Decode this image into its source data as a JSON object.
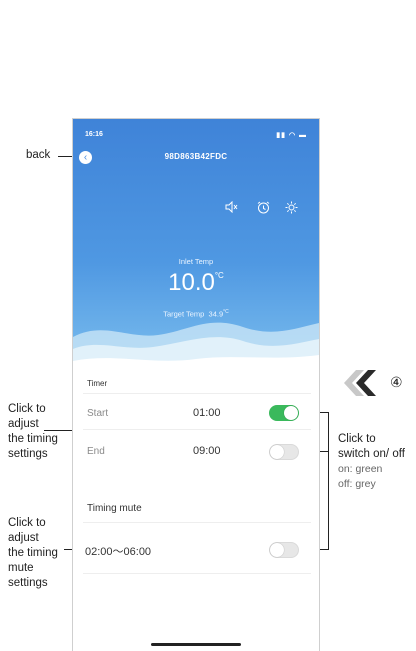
{
  "status_bar": {
    "time": "16:16",
    "icons": "signal-wifi-battery"
  },
  "header": {
    "device_id": "98D863B42FDC",
    "back_label": "back",
    "icons": [
      "mute-icon",
      "alarm-clock-icon",
      "sun-icon"
    ],
    "inlet_label": "Inlet Temp",
    "inlet_value": "10.0",
    "inlet_unit": "°C",
    "target_label": "Target Temp",
    "target_value": "34.9",
    "target_unit": "°C"
  },
  "timer": {
    "title": "Timer",
    "start_label": "Start",
    "start_time": "01:00",
    "start_enabled": true,
    "end_label": "End",
    "end_time": "09:00",
    "end_enabled": false
  },
  "timing_mute": {
    "title": "Timing mute",
    "range": "02:00～06:00",
    "enabled": false
  },
  "annotations": {
    "step_number": "④",
    "adjust_timing": [
      "Click to",
      "adjust",
      "the timing",
      "settings"
    ],
    "adjust_mute": [
      "Click to",
      "adjust",
      "the timing",
      "mute",
      "settings"
    ],
    "switch_title": [
      "Click to",
      "switch on/ off"
    ],
    "switch_on": "on: green",
    "switch_off": "off: grey"
  },
  "colors": {
    "on": "#3ab95c",
    "off": "#e7e7e7",
    "header": "#4a8ee0"
  }
}
